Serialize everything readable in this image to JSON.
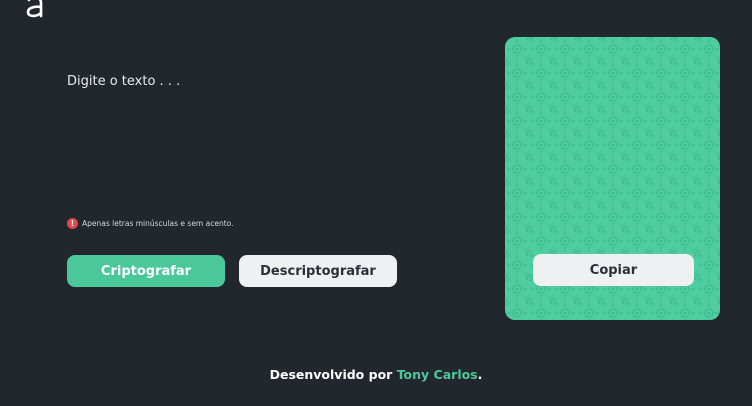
{
  "logo": {
    "icon": "alura-logo-icon",
    "glyph": "a"
  },
  "editor": {
    "placeholder": "Digite o texto . . .",
    "value": ""
  },
  "hint": {
    "icon": "alert-icon",
    "icon_glyph": "!",
    "text": "Apenas letras minúsculas e sem acento."
  },
  "actions": {
    "encrypt_label": "Criptografar",
    "decrypt_label": "Descriptografar"
  },
  "output": {
    "copy_label": "Copiar"
  },
  "footer": {
    "prefix": "Desenvolvido por ",
    "author": "Tony Carlos",
    "suffix": "."
  },
  "colors": {
    "background": "#22272e",
    "accent": "#4bc89a",
    "light_button": "#eef0f2",
    "alert": "#e0474f"
  }
}
